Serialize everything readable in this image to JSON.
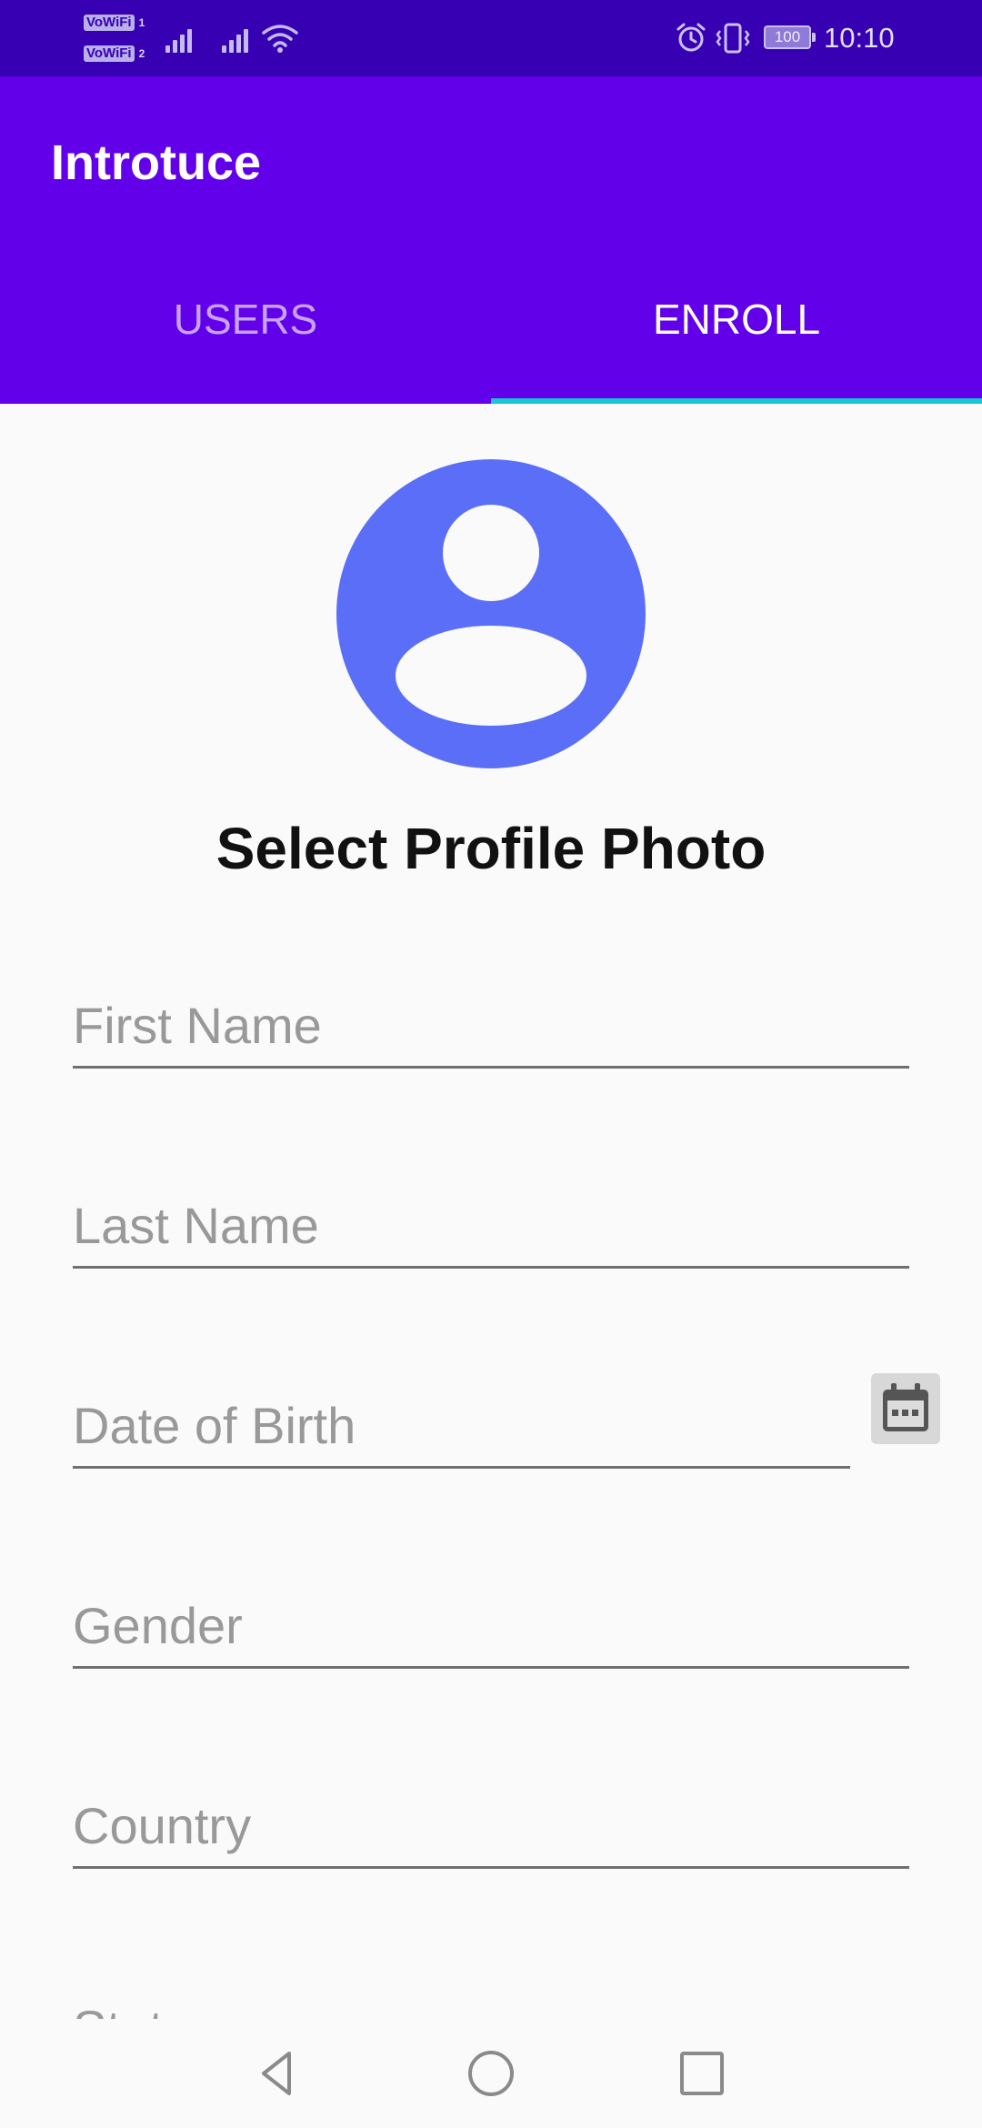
{
  "status_bar": {
    "vowifi_1": "VoWiFi",
    "vowifi_1_sim": "1",
    "vowifi_2": "VoWiFi",
    "vowifi_2_sim": "2",
    "battery": "100",
    "time": "10:10",
    "icons": [
      "signal-icon",
      "signal-icon",
      "wifi-icon",
      "alarm-icon",
      "vibrate-icon",
      "battery-icon"
    ]
  },
  "app_bar": {
    "title": "Introtuce",
    "background_color": "#6200ea",
    "status_bar_color": "#3700b3"
  },
  "tabs": [
    {
      "label": "USERS",
      "selected": false
    },
    {
      "label": "ENROLL",
      "selected": true
    }
  ],
  "tab_indicator_color": "#18c8d1",
  "form": {
    "avatar_icon": "account-circle-icon",
    "avatar_color": "#5b6ef7",
    "select_photo_label": "Select Profile Photo",
    "fields": {
      "first_name": {
        "placeholder": "First Name",
        "value": ""
      },
      "last_name": {
        "placeholder": "Last Name",
        "value": ""
      },
      "date_of_birth": {
        "placeholder": "Date of Birth",
        "value": ""
      },
      "gender": {
        "placeholder": "Gender",
        "value": ""
      },
      "country": {
        "placeholder": "Country",
        "value": ""
      },
      "state": {
        "placeholder": "State",
        "value": ""
      }
    },
    "calendar_icon": "calendar-icon"
  },
  "nav_bar": {
    "icons": [
      "back-icon",
      "home-icon",
      "recent-apps-icon"
    ]
  }
}
